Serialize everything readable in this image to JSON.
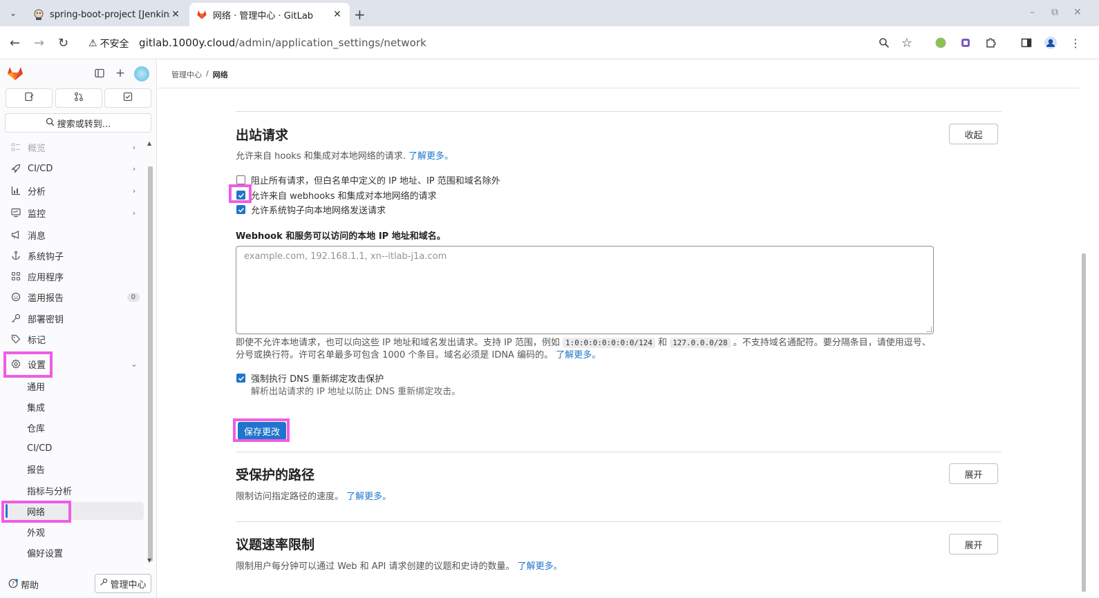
{
  "browser": {
    "tabs": [
      {
        "title": "spring-boot-project [Jenkins]",
        "active": false
      },
      {
        "title": "网络 · 管理中心 · GitLab",
        "active": true
      }
    ],
    "security_label": "不安全",
    "url_host": "gitlab.1000y.cloud",
    "url_path": "/admin/application_settings/network"
  },
  "sidebar": {
    "search_label": "搜索或转到...",
    "items": [
      {
        "label": "概览",
        "icon": "overview-icon"
      },
      {
        "label": "CI/CD",
        "icon": "rocket-icon"
      },
      {
        "label": "分析",
        "icon": "chart-icon"
      },
      {
        "label": "监控",
        "icon": "monitor-icon"
      },
      {
        "label": "消息",
        "icon": "bullhorn-icon"
      },
      {
        "label": "系统钩子",
        "icon": "anchor-icon"
      },
      {
        "label": "应用程序",
        "icon": "apps-icon"
      },
      {
        "label": "滥用报告",
        "icon": "abuse-icon",
        "badge": "0"
      },
      {
        "label": "部署密钥",
        "icon": "key-icon"
      },
      {
        "label": "标记",
        "icon": "label-icon"
      },
      {
        "label": "设置",
        "icon": "gear-icon"
      }
    ],
    "settings_sub": [
      "通用",
      "集成",
      "仓库",
      "CI/CD",
      "报告",
      "指标与分析",
      "网络",
      "外观",
      "偏好设置"
    ],
    "help_label": "帮助",
    "admin_label": "管理中心"
  },
  "breadcrumb": {
    "parent": "管理中心",
    "current": "网络"
  },
  "outbound": {
    "title": "出站请求",
    "desc": "允许来自 hooks 和集成对本地网络的请求.",
    "learn_more": "了解更多。",
    "collapse_label": "收起",
    "checkboxes": [
      {
        "label": "阻止所有请求，但白名单中定义的 IP 地址、IP 范围和域名除外",
        "checked": false
      },
      {
        "label": "允许来自 webhooks 和集成对本地网络的请求",
        "checked": true
      },
      {
        "label": "允许系统钩子向本地网络发送请求",
        "checked": true
      }
    ],
    "field_label": "Webhook 和服务可以访问的本地 IP 地址和域名。",
    "placeholder": "example.com, 192.168.1.1, xn--itlab-j1a.com",
    "help_part1": "即使不允许本地请求，也可以向这些 IP 地址和域名发出请求。支持 IP 范围，例如",
    "code1": "1:0:0:0:0:0:0:0/124",
    "and": "和",
    "code2": "127.0.0.0/28",
    "help_part2": "。不支持域名通配符。要分隔条目，请使用逗号、分号或换行符。许可名单最多可包含 1000 个条目。域名必须是 IDNA 编码的。",
    "help_link": "了解更多。",
    "dns_label": "强制执行 DNS 重新绑定攻击保护",
    "dns_checked": true,
    "dns_help": "解析出站请求的 IP 地址以防止 DNS 重新绑定攻击。",
    "save_label": "保存更改"
  },
  "protected_paths": {
    "title": "受保护的路径",
    "desc": "限制访问指定路径的速度。",
    "learn_more": "了解更多。",
    "expand_label": "展开"
  },
  "issue_rate": {
    "title": "议题速率限制",
    "desc": "限制用户每分钟可以通过 Web 和 API 请求创建的议题和史诗的数量。",
    "learn_more": "了解更多。",
    "expand_label": "展开"
  },
  "colors": {
    "accent": "#1f75cb",
    "highlight": "#f05ce6"
  }
}
